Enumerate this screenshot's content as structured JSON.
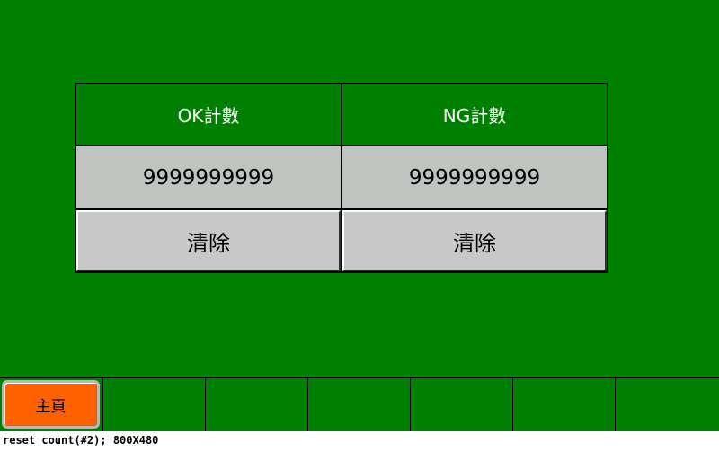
{
  "counters": [
    {
      "header": "OK計數",
      "value": "9999999999",
      "clear_label": "清除"
    },
    {
      "header": "NG計數",
      "value": "9999999999",
      "clear_label": "清除"
    }
  ],
  "nav": {
    "home_label": "主頁"
  },
  "status": {
    "text": "reset count(#2); 800X480"
  },
  "colors": {
    "screen_bg": "#008000",
    "value_cell_bg": "#c0c4c0",
    "home_button_bg": "#ff6000"
  }
}
